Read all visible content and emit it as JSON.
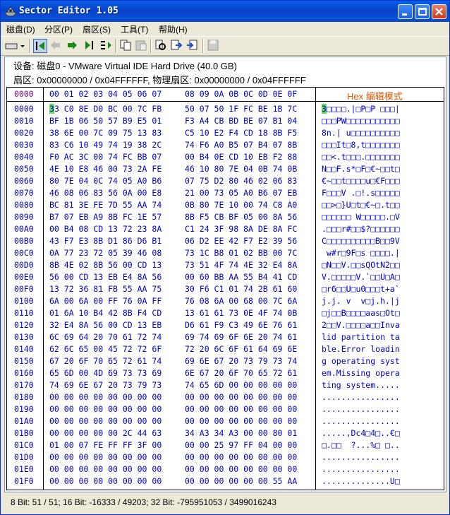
{
  "window": {
    "title": "Sector Editor 1.05"
  },
  "menu": [
    {
      "label": "磁盘(D)",
      "name": "menu-disk"
    },
    {
      "label": "分区(P)",
      "name": "menu-partition"
    },
    {
      "label": "扇区(S)",
      "name": "menu-sector"
    },
    {
      "label": "工具(T)",
      "name": "menu-tools"
    },
    {
      "label": "帮助(H)",
      "name": "menu-help"
    }
  ],
  "toolbar": {
    "icons": [
      "drive-dropdown-icon",
      "first-sector-icon",
      "prev-sector-icon",
      "next-sector-icon",
      "last-sector-icon",
      "goto-sector-icon",
      "copy-icon",
      "paste-icon",
      "search-icon",
      "export-icon",
      "import-icon",
      "save-icon"
    ]
  },
  "info": {
    "device_line": "设备: 磁盘0 - VMware Virtual IDE Hard Drive (40.0 GB)",
    "sector_line": "扇区: 0x00000000 / 0x04FFFFFF, 物理扇区: 0x00000000 / 0x04FFFFFF"
  },
  "grid": {
    "corner_offset": "0000",
    "hex_header_a": "00 01 02 03 04 05 06 07",
    "hex_header_b": "08 09 0A 0B 0C 0D 0E 0F",
    "mode_label": "Hex 编辑模式",
    "rows": [
      {
        "off": "0000",
        "a": "33 C0 8E D0 BC 00 7C FB",
        "b": "50 07 50 1F FC BE 1B 7C",
        "asc": "3□□□□.|□P□P □□□|"
      },
      {
        "off": "0010",
        "a": "BF 1B 06 50 57 B9 E5 01",
        "b": "F3 A4 CB BD BE 07 B1 04",
        "asc": "□□□PW□□□□□□□□□□□"
      },
      {
        "off": "0020",
        "a": "38 6E 00 7C 09 75 13 83",
        "b": "C5 10 E2 F4 CD 18 8B F5",
        "asc": "8n.| u□□□□□□□□□□"
      },
      {
        "off": "0030",
        "a": "83 C6 10 49 74 19 38 2C",
        "b": "74 F6 A0 B5 07 B4 07 8B",
        "asc": "□□□It□8,t□□□□□□□"
      },
      {
        "off": "0040",
        "a": "F0 AC 3C 00 74 FC BB 07",
        "b": "00 B4 0E CD 10 EB F2 88",
        "asc": "□□<.t□□□.□□□□□□□"
      },
      {
        "off": "0050",
        "a": "4E 10 E8 46 00 73 2A FE",
        "b": "46 10 80 7E 04 0B 74 0B",
        "asc": "N□□F.s*□F□€~□□t□"
      },
      {
        "off": "0060",
        "a": "80 7E 04 0C 74 05 A0 B6",
        "b": "07 75 D2 80 46 02 06 83",
        "asc": "€~□□t□□□□u□€F□□□"
      },
      {
        "off": "0070",
        "a": "46 08 06 83 56 0A 00 E8",
        "b": "21 00 73 05 A0 B6 07 EB",
        "asc": "F□□□V .□!.s□□□□□"
      },
      {
        "off": "0080",
        "a": "BC 81 3E FE 7D 55 AA 74",
        "b": "0B 80 7E 10 00 74 C8 A0",
        "asc": "□□>□}U□t□€~□.t□□"
      },
      {
        "off": "0090",
        "a": "B7 07 EB A9 8B FC 1E 57",
        "b": "8B F5 CB BF 05 00 8A 56",
        "asc": "□□□□□□ W□□□□□.□V"
      },
      {
        "off": "00A0",
        "a": "00 B4 08 CD 13 72 23 8A",
        "b": "C1 24 3F 98 8A DE 8A FC",
        "asc": ".□□□r#□□$?□□□□□□"
      },
      {
        "off": "00B0",
        "a": "43 F7 E3 8B D1 86 D6 B1",
        "b": "06 D2 EE 42 F7 E2 39 56",
        "asc": "C□□□□□□□□□□B□□9V"
      },
      {
        "off": "00C0",
        "a": "0A 77 23 72 05 39 46 08",
        "b": "73 1C B8 01 02 BB 00 7C",
        "asc": " w#r□9F□s □□□□.|"
      },
      {
        "off": "00D0",
        "a": "8B 4E 02 8B 56 00 CD 13",
        "b": "73 51 4F 74 4E 32 E4 8A",
        "asc": "□N□□V.□□sQOtN2□□"
      },
      {
        "off": "00E0",
        "a": "56 00 CD 13 EB E4 8A 56",
        "b": "00 60 BB AA 55 B4 41 CD",
        "asc": "V.□□□□□V.`□□U□A□"
      },
      {
        "off": "00F0",
        "a": "13 72 36 81 FB 55 AA 75",
        "b": "30 F6 C1 01 74 2B 61 60",
        "asc": "□r6□□U□u0□□□t+a`"
      },
      {
        "off": "0100",
        "a": "6A 00 6A 00 FF 76 0A FF",
        "b": "76 08 6A 00 68 00 7C 6A",
        "asc": "j.j. v  v□j.h.|j"
      },
      {
        "off": "0110",
        "a": "01 6A 10 B4 42 8B F4 CD",
        "b": "13 61 61 73 0E 4F 74 0B",
        "asc": "□j□□B□□□□aas□Ot□"
      },
      {
        "off": "0120",
        "a": "32 E4 8A 56 00 CD 13 EB",
        "b": "D6 61 F9 C3 49 6E 76 61",
        "asc": "2□□V.□□□□a□□Inva"
      },
      {
        "off": "0130",
        "a": "6C 69 64 20 70 61 72 74",
        "b": "69 74 69 6F 6E 20 74 61",
        "asc": "lid partition ta"
      },
      {
        "off": "0140",
        "a": "62 6C 65 00 45 72 72 6F",
        "b": "72 20 6C 6F 61 64 69 6E",
        "asc": "ble.Error loadin"
      },
      {
        "off": "0150",
        "a": "67 20 6F 70 65 72 61 74",
        "b": "69 6E 67 20 73 79 73 74",
        "asc": "g operating syst"
      },
      {
        "off": "0160",
        "a": "65 6D 00 4D 69 73 73 69",
        "b": "6E 67 20 6F 70 65 72 61",
        "asc": "em.Missing opera"
      },
      {
        "off": "0170",
        "a": "74 69 6E 67 20 73 79 73",
        "b": "74 65 6D 00 00 00 00 00",
        "asc": "ting system....."
      },
      {
        "off": "0180",
        "a": "00 00 00 00 00 00 00 00",
        "b": "00 00 00 00 00 00 00 00",
        "asc": "................"
      },
      {
        "off": "0190",
        "a": "00 00 00 00 00 00 00 00",
        "b": "00 00 00 00 00 00 00 00",
        "asc": "................"
      },
      {
        "off": "01A0",
        "a": "00 00 00 00 00 00 00 00",
        "b": "00 00 00 00 00 00 00 00",
        "asc": "................"
      },
      {
        "off": "01B0",
        "a": "00 00 00 00 00 2C 44 63",
        "b": "34 A3 34 A3 00 00 80 01",
        "asc": ".....,Dc4□4□..€□"
      },
      {
        "off": "01C0",
        "a": "01 00 07 FE FF FF 3F 00",
        "b": "00 00 25 97 FF 04 00 00",
        "asc": "□.□□  ?...%□ □.."
      },
      {
        "off": "01D0",
        "a": "00 00 00 00 00 00 00 00",
        "b": "00 00 00 00 00 00 00 00",
        "asc": "................"
      },
      {
        "off": "01E0",
        "a": "00 00 00 00 00 00 00 00",
        "b": "00 00 00 00 00 00 00 00",
        "asc": "................"
      },
      {
        "off": "01F0",
        "a": "00 00 00 00 00 00 00 00",
        "b": "00 00 00 00 00 00 55 AA",
        "asc": "..............U□"
      }
    ]
  },
  "status": {
    "text": "8 Bit: 51 / 51;  16 Bit: -16333 / 49203;  32 Bit: -795951053 / 3499016243"
  },
  "colors": {
    "title_bar": "#0A52D8",
    "hex_text": "#0000C0",
    "header_offset": "#7A0080",
    "mode_label": "#E05A00",
    "cursor_highlight": "#6AD86A"
  }
}
